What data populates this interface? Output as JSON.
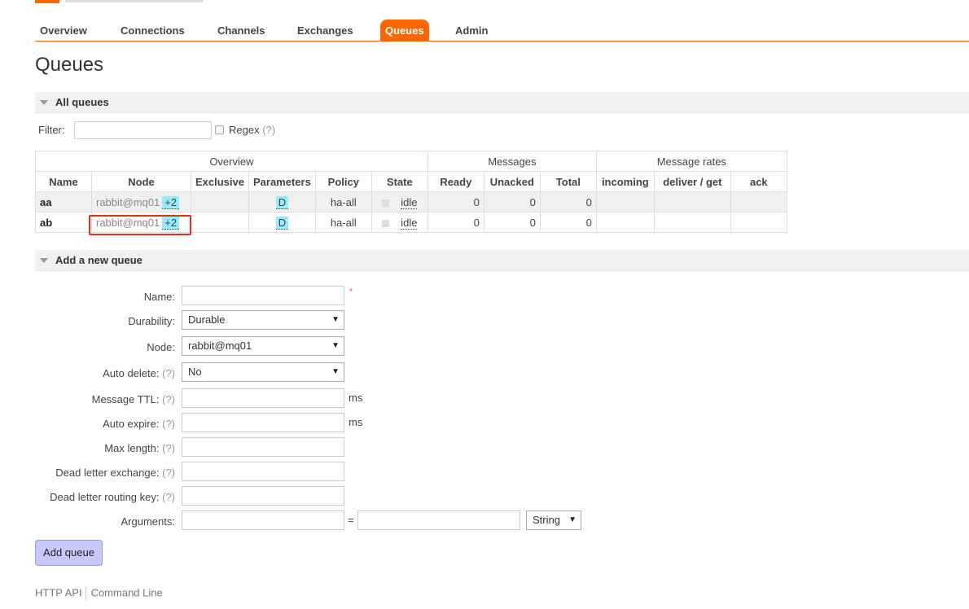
{
  "nav": {
    "items": [
      {
        "label": "Overview",
        "active": false
      },
      {
        "label": "Connections",
        "active": false
      },
      {
        "label": "Channels",
        "active": false
      },
      {
        "label": "Exchanges",
        "active": false
      },
      {
        "label": "Queues",
        "active": true
      },
      {
        "label": "Admin",
        "active": false
      }
    ],
    "accent": "#ff6600"
  },
  "page_title": "Queues",
  "all_queues": {
    "section_title": "All queues",
    "filter_label": "Filter:",
    "filter_value": "",
    "regex_label": "Regex",
    "regex_help": "(?)",
    "group_headers": [
      "Overview",
      "Messages",
      "Message rates"
    ],
    "columns": [
      "Name",
      "Node",
      "Exclusive",
      "Parameters",
      "Policy",
      "State",
      "Ready",
      "Unacked",
      "Total",
      "incoming",
      "deliver / get",
      "ack"
    ],
    "rows": [
      {
        "name": "aa",
        "node": "rabbit@mq01",
        "node_extra": "+2",
        "exclusive": "",
        "parameters": "D",
        "policy": "ha-all",
        "state": "idle",
        "ready": "0",
        "unacked": "0",
        "total": "0",
        "incoming": "",
        "deliver_get": "",
        "ack": ""
      },
      {
        "name": "ab",
        "node": "rabbit@mq01",
        "node_extra": "+2",
        "exclusive": "",
        "parameters": "D",
        "policy": "ha-all",
        "state": "idle",
        "ready": "0",
        "unacked": "0",
        "total": "0",
        "incoming": "",
        "deliver_get": "",
        "ack": ""
      }
    ]
  },
  "add_queue": {
    "section_title": "Add a new queue",
    "required_mark": "*",
    "help": "(?)",
    "fields": {
      "name": {
        "label": "Name:",
        "value": ""
      },
      "durability": {
        "label": "Durability:",
        "value": "Durable"
      },
      "node": {
        "label": "Node:",
        "value": "rabbit@mq01"
      },
      "auto_delete": {
        "label": "Auto delete:",
        "value": "No"
      },
      "message_ttl": {
        "label": "Message TTL:",
        "value": "",
        "unit": "ms"
      },
      "auto_expire": {
        "label": "Auto expire:",
        "value": "",
        "unit": "ms"
      },
      "max_length": {
        "label": "Max length:",
        "value": ""
      },
      "dlx": {
        "label": "Dead letter exchange:",
        "value": ""
      },
      "dlrk": {
        "label": "Dead letter routing key:",
        "value": ""
      },
      "arguments": {
        "label": "Arguments:",
        "key": "",
        "eq": "=",
        "value": "",
        "type": "String"
      }
    },
    "submit_label": "Add queue"
  },
  "footer": {
    "links": [
      "HTTP API",
      "Command Line"
    ]
  }
}
